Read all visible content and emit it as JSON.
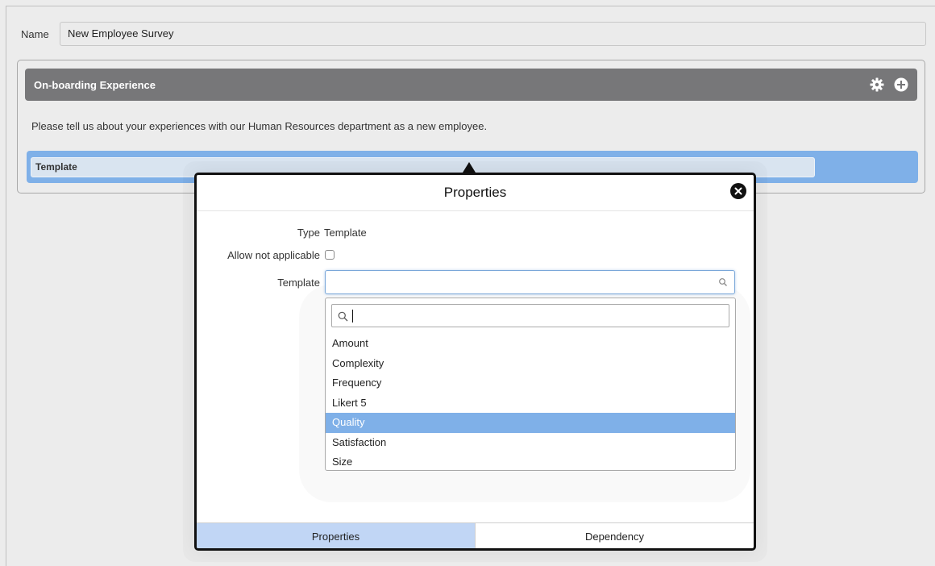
{
  "form": {
    "name_label": "Name",
    "name_value": "New Employee Survey"
  },
  "section": {
    "title": "On-boarding Experience",
    "description": "Please tell us about your experiences with our Human Resources department as a new employee.",
    "header_icons": [
      "gear-icon",
      "add-circle-icon"
    ]
  },
  "question": {
    "field_value": "Template"
  },
  "properties_popover": {
    "title": "Properties",
    "type_label": "Type",
    "type_value": "Template",
    "allow_na_label": "Allow not applicable",
    "allow_na_checked": false,
    "template_label": "Template",
    "template_value": "",
    "dropdown": {
      "search_value": "",
      "options": [
        "Amount",
        "Complexity",
        "Frequency",
        "Likert 5",
        "Quality",
        "Satisfaction",
        "Size"
      ],
      "highlighted": "Quality"
    },
    "tabs": [
      {
        "label": "Properties",
        "active": true
      },
      {
        "label": "Dependency",
        "active": false
      }
    ]
  },
  "colors": {
    "section_header": "#777779",
    "question_bar": "#7fb0e8",
    "highlight": "#7fb0e8",
    "active_tab": "#c1d6f5"
  }
}
